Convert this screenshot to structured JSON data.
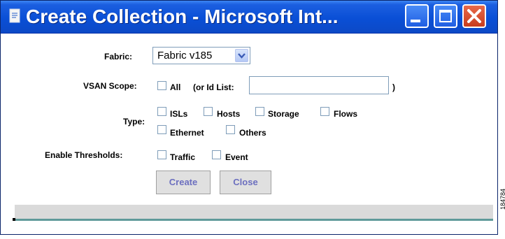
{
  "window": {
    "title": "Create Collection - Microsoft Int..."
  },
  "form": {
    "fabric_label": "Fabric:",
    "fabric_value": "Fabric v185",
    "vsan_label": "VSAN Scope:",
    "vsan_all": "All",
    "vsan_idlist": "(or Id List:",
    "vsan_close_paren": ")",
    "vsan_idlist_value": "",
    "type_label": "Type:",
    "type_options": [
      "ISLs",
      "Hosts",
      "Storage",
      "Flows",
      "Ethernet",
      "Others"
    ],
    "thresholds_label": "Enable Thresholds:",
    "threshold_options": [
      "Traffic",
      "Event"
    ]
  },
  "buttons": {
    "create": "Create",
    "close": "Close"
  },
  "side_id": "184784",
  "colors": {
    "titlebar": "#0a4fd6",
    "close_button": "#c83d1d",
    "button_text": "#6c6fbf",
    "status_line": "#5f9a9a"
  }
}
